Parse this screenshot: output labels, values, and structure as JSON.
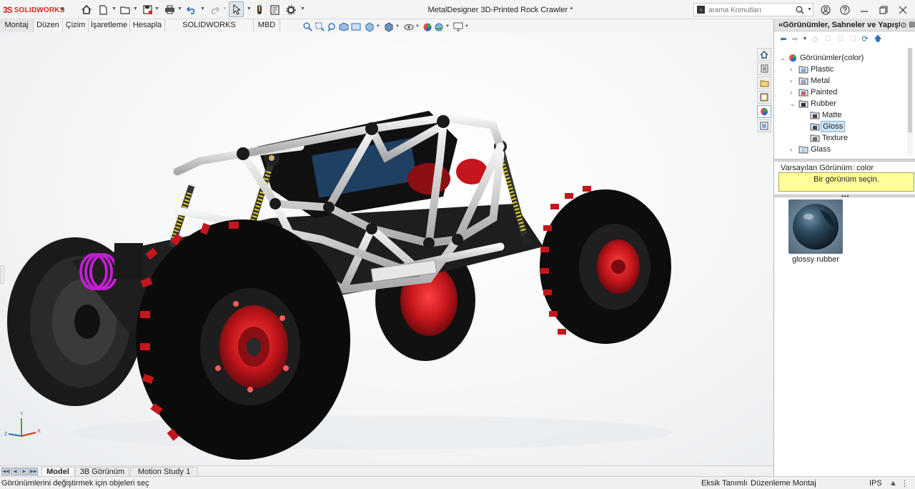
{
  "app": {
    "brand_ds": "3S",
    "brand_name": "SOLIDWORKS",
    "doc_title": "MetalDesigner 3D-Printed Rock Crawler *"
  },
  "quick_access": {
    "icons": [
      "home-icon",
      "new-file-icon",
      "open-icon",
      "save-icon",
      "print-icon",
      "undo-icon",
      "redo-icon",
      "select-icon",
      "rebuild-icon",
      "file-properties-icon",
      "options-icon"
    ]
  },
  "search": {
    "placeholder": "arama Komutları"
  },
  "command_tabs": [
    "Montaj",
    "Düzen",
    "Çizim",
    "İşaretleme",
    "Hesapla",
    "SOLIDWORKS Eklentileri",
    "MBD"
  ],
  "heads_up_view": {
    "icons": [
      "zoom-to-fit-icon",
      "zoom-area-icon",
      "previous-view-icon",
      "section-view-icon",
      "dynamic-annotation-icon",
      "view-orientation-icon",
      "display-style-icon",
      "hide-show-icon",
      "edit-appearance-icon",
      "apply-scene-icon",
      "view-settings-icon"
    ]
  },
  "task_pane_tabs": [
    "home-icon",
    "design-library-icon",
    "file-explorer-icon",
    "view-palette-icon",
    "appearances-icon",
    "custom-properties-icon"
  ],
  "task_pane": {
    "title": "Görünümler, Sahneler ve Yapıştır...",
    "tree": {
      "root": "Görünümler(color)",
      "items": [
        {
          "label": "Plastic",
          "expanded": false
        },
        {
          "label": "Metal",
          "expanded": false
        },
        {
          "label": "Painted",
          "expanded": false
        },
        {
          "label": "Rubber",
          "expanded": true,
          "children": [
            {
              "label": "Matte"
            },
            {
              "label": "Gloss",
              "selected": true
            },
            {
              "label": "Texture"
            }
          ]
        },
        {
          "label": "Glass",
          "expanded": false
        }
      ]
    },
    "default_appearance": "Varsayılan Görünüm: color",
    "hint": "Bir görünüm seçin.",
    "swatch": {
      "label": "glossy rubber",
      "color": "#2d4a5e"
    }
  },
  "bottom_tabs": [
    {
      "label": "Model",
      "active": true
    },
    {
      "label": "3B Görünüm",
      "active": false
    },
    {
      "label": "Motion Study 1",
      "active": false
    }
  ],
  "status": {
    "message": "Görünümlerini değiştirmek için objeleri seç",
    "definition": "Eksik Tanımlı",
    "mode": "Düzenleme Montaj",
    "units": "IPS"
  },
  "colors": {
    "accent_red": "#d52b1e",
    "wheel_red": "#c4161c",
    "frame": "#d7d7d7",
    "tire": "#111111",
    "spring_yellow": "#e6d21c",
    "spring_magenta": "#c21ed1",
    "hint_yellow": "#ffff99"
  }
}
